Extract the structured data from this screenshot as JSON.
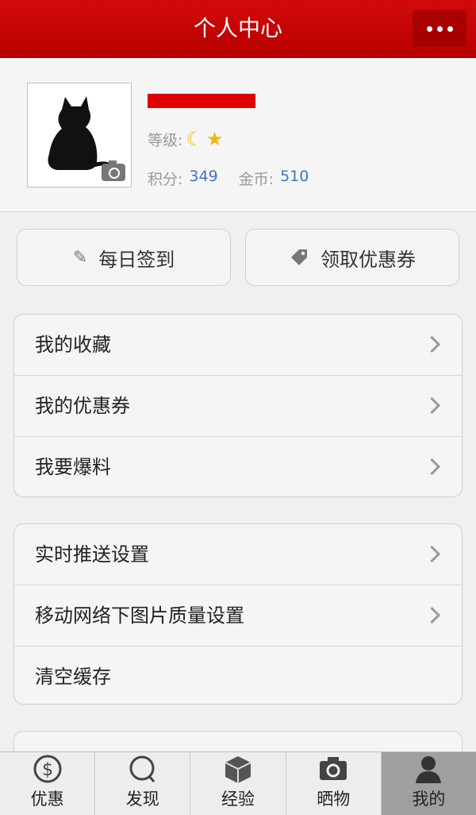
{
  "header": {
    "title": "个人中心",
    "more_icon": "more-dots-icon"
  },
  "profile": {
    "username": "",
    "level_label": "等级:",
    "level_icons": [
      "moon-icon",
      "star-icon"
    ],
    "points_label": "积分:",
    "points_value": "349",
    "coins_label": "金币:",
    "coins_value": "510"
  },
  "actions": {
    "signin_label": "每日签到",
    "coupon_label": "领取优惠券"
  },
  "menu_group_1": [
    {
      "label": "我的收藏"
    },
    {
      "label": "我的优惠券"
    },
    {
      "label": "我要爆料"
    }
  ],
  "menu_group_2": [
    {
      "label": "实时推送设置"
    },
    {
      "label": "移动网络下图片质量设置"
    },
    {
      "label": "清空缓存"
    }
  ],
  "tabs": [
    {
      "label": "优惠",
      "icon": "dollar-icon"
    },
    {
      "label": "发现",
      "icon": "search-icon"
    },
    {
      "label": "经验",
      "icon": "box-icon"
    },
    {
      "label": "晒物",
      "icon": "camera-icon"
    },
    {
      "label": "我的",
      "icon": "person-icon",
      "active": true
    }
  ],
  "colors": {
    "header_red": "#c80000",
    "accent_blue": "#3d76c5",
    "active_tab": "#9f9f9f"
  }
}
